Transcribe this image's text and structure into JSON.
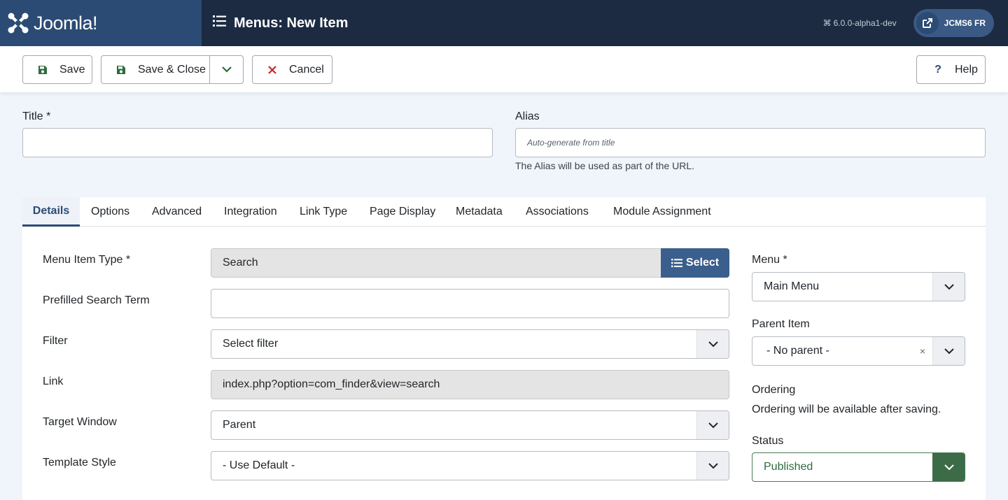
{
  "header": {
    "brand": "Joomla!",
    "title": "Menus: New Item",
    "version": "6.0.0-alpha1-dev",
    "site_label": "JCMS6 FR"
  },
  "toolbar": {
    "save": "Save",
    "save_close": "Save & Close",
    "cancel": "Cancel",
    "help": "Help"
  },
  "form": {
    "title_label": "Title *",
    "title_value": "",
    "alias_label": "Alias",
    "alias_placeholder": "Auto-generate from title",
    "alias_hint": "The Alias will be used as part of the URL."
  },
  "tabs": [
    "Details",
    "Options",
    "Advanced",
    "Integration",
    "Link Type",
    "Page Display",
    "Metadata",
    "Associations",
    "Module Assignment"
  ],
  "active_tab": "Details",
  "details": {
    "menu_item_type_label": "Menu Item Type *",
    "menu_item_type_value": "Search",
    "select_button": "Select",
    "prefilled_label": "Prefilled Search Term",
    "prefilled_value": "",
    "filter_label": "Filter",
    "filter_value": "Select filter",
    "link_label": "Link",
    "link_value": "index.php?option=com_finder&view=search",
    "target_label": "Target Window",
    "target_value": "Parent",
    "template_label": "Template Style",
    "template_value": "- Use Default -"
  },
  "sidebar": {
    "menu_label": "Menu *",
    "menu_value": "Main Menu",
    "parent_label": "Parent Item",
    "parent_value": "- No parent -",
    "clear_glyph": "×",
    "ordering_label": "Ordering",
    "ordering_note": "Ordering will be available after saving.",
    "status_label": "Status",
    "status_value": "Published"
  },
  "colors": {
    "header_bg": "#1c2b42",
    "brand_bg": "#2b4b74",
    "accent": "#3b5f8c",
    "status_green": "#3c6b47",
    "cancel_red": "#c52827"
  }
}
